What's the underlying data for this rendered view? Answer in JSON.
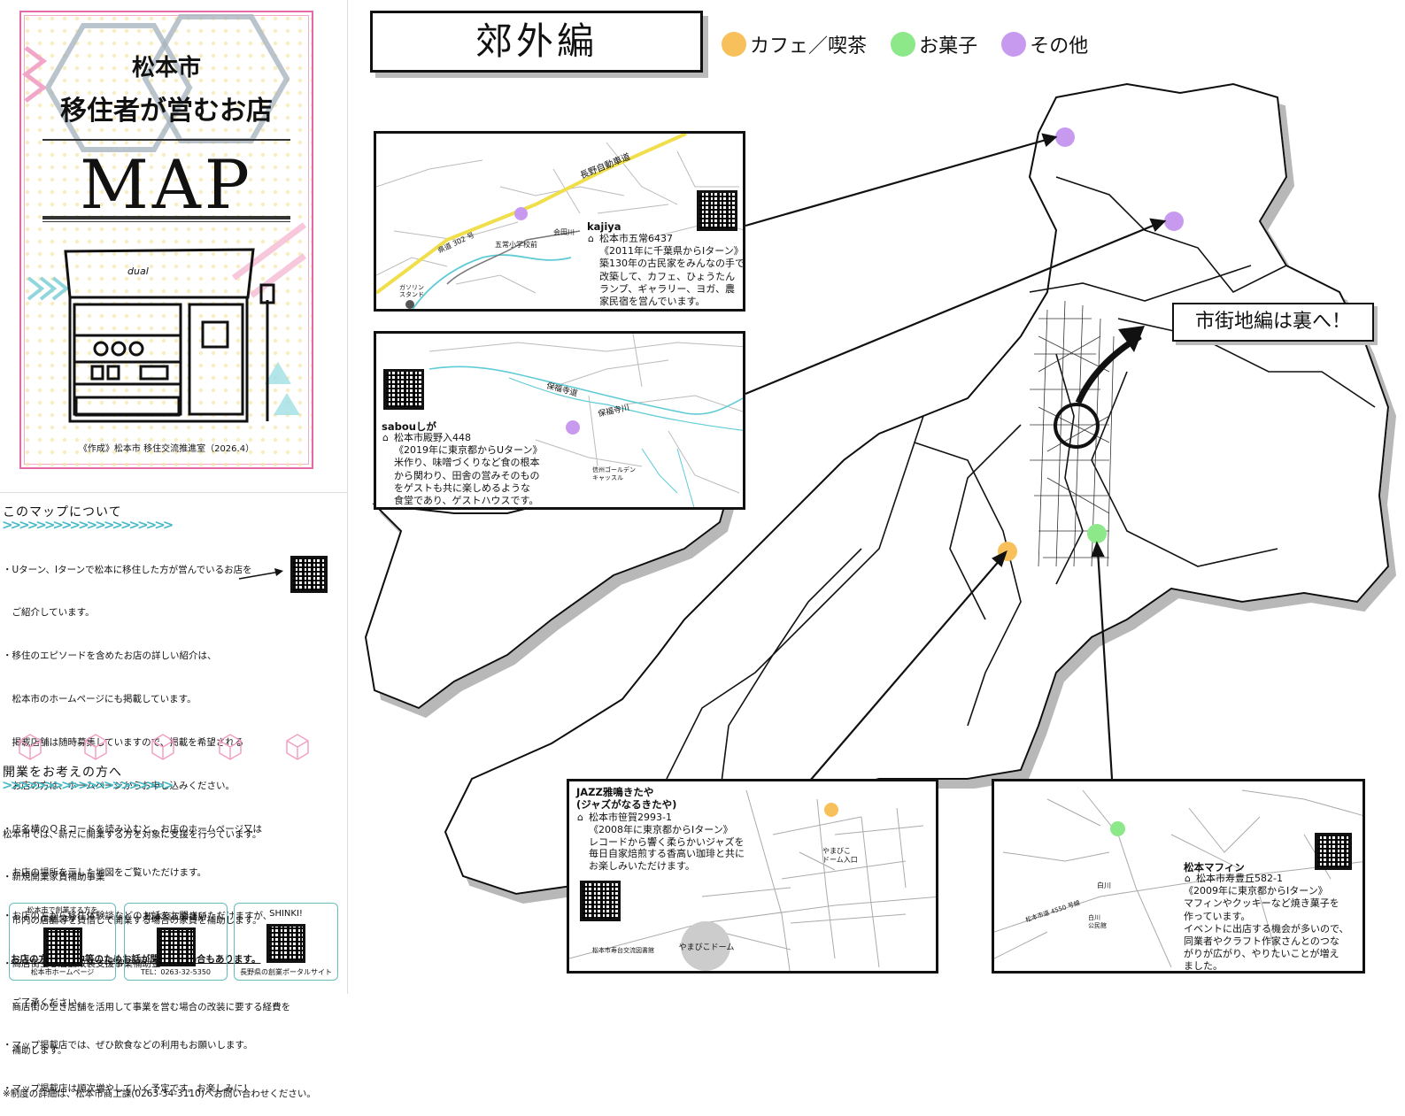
{
  "colors": {
    "cafe": "#f8c05a",
    "sweets": "#8de88a",
    "other": "#c79af0",
    "cover_border": "#e66aa8",
    "accent": "#48b9c6"
  },
  "cover": {
    "title1": "松本市",
    "title2": "移住者が営むお店",
    "map_word": "MAP",
    "credit": "《作成》松本市 移住交流推進室（2026.4）",
    "shop_sign": "dual"
  },
  "about": {
    "heading": "このマップについて",
    "lines": [
      "・Uターン、Iターンで松本に移住した方が営んでいるお店を",
      "　ご紹介しています。",
      "・移住のエピソードを含めたお店の詳しい紹介は、",
      "　松本市のホームページにも掲載しています。",
      "　掲載店舗は随時募集していますので、掲載を希望される",
      "　お店の方は、ホームページからお申し込みください。",
      "・店名横のＱＲコードを読み込むと、お店のホームページ又は",
      "　お店の場所を示した地図をご覧いただけます。",
      "・お店の方から移住体験談などのお話をお聞きいただけますが、"
    ],
    "underline": "お店の方が接客中等のためお話が聞けない場合もあります。",
    "lines2": [
      "　ご了承ください。",
      "・マップ掲載店では、ぜひ飲食などの利用もお願いします。",
      "・マップ掲載店は順次増やしていく予定です。お楽しみに！"
    ]
  },
  "business": {
    "heading": "開業をお考えの方へ",
    "lines": [
      "松本市では、新たに開業する方を対象に支援を行っています。",
      "・新規開業家賃補助事業",
      "　市内の店舗等を賃借して開業する場合の家賃を補助します。",
      "・商店街空き店舗改装支援事業補助金",
      "　商店街の空き店舗を活用して事業を営む場合の改装に要する経費を",
      "　補助します。",
      "※制度の詳細は、松本市商工課(0263-34-3110)へお問い合わせください。"
    ],
    "boxes": [
      {
        "title": "松本市で創業する方を\n応援します！",
        "caption": "松本市ホームページ"
      },
      {
        "title": "松本商工会議所",
        "caption": "TEL：0263-32-5350"
      },
      {
        "title": "SHINKI!",
        "caption": "長野県の創業ポータルサイト"
      }
    ]
  },
  "header": {
    "title": "郊外編"
  },
  "legend": [
    {
      "label": "カフェ／喫茶",
      "color_key": "cafe"
    },
    {
      "label": "お菓子",
      "color_key": "sweets"
    },
    {
      "label": "その他",
      "color_key": "other"
    }
  ],
  "city_note": "市街地編は裏へ！",
  "shops": {
    "kajiya": {
      "name": "kajiya",
      "text": "松本市五常6437\n《2011年に千葉県からIターン》\n築130年の古民家をみんなの手で\n改築して、カフェ、ひょうたん\nランプ、ギャラリー、ヨガ、農\n家民宿を営んでいます。",
      "labels": [
        "長野自動車道",
        "県道 302 号",
        "五常小学校前",
        "会田川",
        "ガソリン\nスタンド"
      ]
    },
    "saboushiga": {
      "name": "sabouしが",
      "text": "松本市殿野入448\n《2019年に東京都からUターン》\n米作り、味噌づくりなど食の根本\nから関わり、田舎の営みそのもの\nをゲストも共に楽しめるような\n食堂であり、ゲストハウスです。",
      "labels": [
        "保福寺道",
        "保福寺川",
        "信州ゴールデン\nキャッスル"
      ]
    },
    "jazz": {
      "name": "JAZZ雅鳴きたや\n(ジャズがなるきたや)",
      "text": "松本市笹賀2993-1\n《2008年に東京都からIターン》\nレコードから響く柔らかいジャズを\n毎日自家焙煎する香高い珈琲と共に\nお楽しみいただけます。",
      "labels": [
        "やまびこ\nドーム入口",
        "松本市寿台交流図書館",
        "やまびこドーム"
      ]
    },
    "muffin": {
      "name": "松本マフィン",
      "text": "松本市寿豊丘582-1\n《2009年に東京都からIターン》\nマフィンやクッキーなど焼き菓子を\n作っています。\nイベントに出店する機会が多いので、\n同業者やクラフト作家さんとのつな\nがりが広がり、やりたいことが増え\nました。",
      "labels": [
        "白川",
        "松本市道 4550 号線",
        "白川\n公民館"
      ]
    }
  }
}
